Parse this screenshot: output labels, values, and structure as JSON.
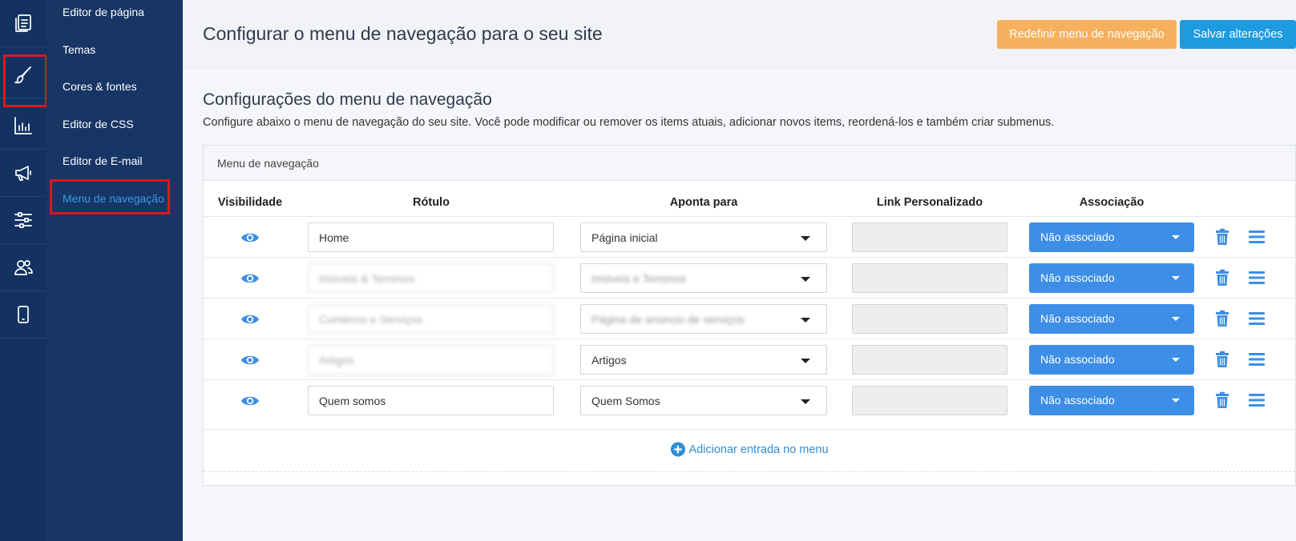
{
  "sidebar": {
    "items": [
      {
        "label": "Editor de página"
      },
      {
        "label": "Temas"
      },
      {
        "label": "Cores & fontes"
      },
      {
        "label": "Editor de CSS"
      },
      {
        "label": "Editor de E-mail"
      },
      {
        "label": "Menu de navegação"
      }
    ],
    "rail_icons": [
      "pages-icon",
      "brush-icon",
      "analytics-icon",
      "megaphone-icon",
      "sliders-icon",
      "users-icon",
      "mobile-icon"
    ]
  },
  "header": {
    "title": "Configurar o menu de navegação para o seu site",
    "reset_label": "Redefinir menu de navegação",
    "save_label": "Salvar alterações"
  },
  "section": {
    "title": "Configurações do menu de navegação",
    "description": "Configure abaixo o menu de navegação do seu site. Você pode modificar ou remover os items atuais, adicionar novos items, reordená-los e também criar submenus."
  },
  "panel": {
    "title": "Menu de navegação",
    "columns": {
      "visibility": "Visibilidade",
      "label": "Rótulo",
      "points_to": "Aponta para",
      "custom_link": "Link Personalizado",
      "association": "Associação"
    },
    "rows": [
      {
        "label": "Home",
        "points_to": "Página inicial",
        "association": "Não associado",
        "label_blurred": false,
        "points_blurred": false
      },
      {
        "label": "Imóveis & Terrenos",
        "points_to": "Imóveis e Terrenos",
        "association": "Não associado",
        "label_blurred": true,
        "points_blurred": true
      },
      {
        "label": "Comércio e Serviços",
        "points_to": "Página de anúncio de serviços",
        "association": "Não associado",
        "label_blurred": true,
        "points_blurred": true
      },
      {
        "label": "Artigos",
        "points_to": "Artigos",
        "association": "Não associado",
        "label_blurred": true,
        "points_blurred": false
      },
      {
        "label": "Quem somos",
        "points_to": "Quem Somos",
        "association": "Não associado",
        "label_blurred": false,
        "points_blurred": false
      }
    ],
    "add_label": "Adicionar entrada no menu"
  },
  "colors": {
    "rail_bg": "#133262",
    "sidebar_bg": "#173565",
    "highlight": "#e0161c",
    "reset_button": "#f6b05e",
    "save_button": "#1e9ae1",
    "association_button": "#3d8ee6",
    "link_accent": "#2e8ed8"
  }
}
